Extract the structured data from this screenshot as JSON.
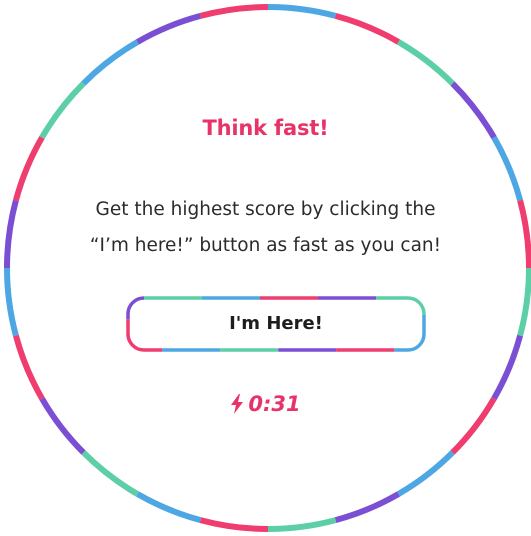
{
  "game": {
    "title": "Think fast!",
    "description_lines": [
      "Get the highest score by clicking the",
      "“I’m here!” button as fast as you can!"
    ],
    "button_label": "I'm Here!",
    "timer": "0:31"
  },
  "icons": {
    "timer_icon": "lightning-bolt"
  },
  "colors": {
    "accent": "#e8336a",
    "ring_colors": [
      "#ee3d6e",
      "#4da7e2",
      "#7b4fd3",
      "#5ccfa6"
    ],
    "text": "#2b2b2b"
  }
}
